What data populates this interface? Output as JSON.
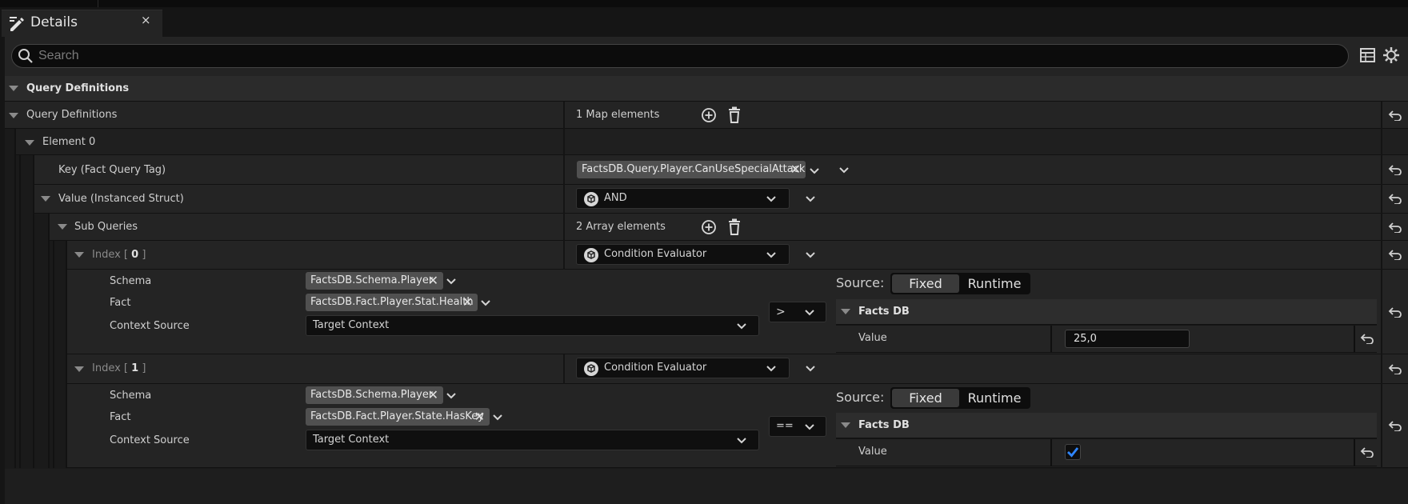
{
  "tab": {
    "title": "Details",
    "close": "×"
  },
  "search": {
    "placeholder": "Search"
  },
  "section": {
    "title": "Query Definitions"
  },
  "map": {
    "label": "Query Definitions",
    "count": "1 Map elements"
  },
  "element": {
    "label": "Element 0"
  },
  "key": {
    "label": "Key (Fact Query Tag)",
    "value": "FactsDB.Query.Player.CanUseSpecialAttack"
  },
  "value_struct": {
    "label": "Value (Instanced Struct)",
    "value": "AND"
  },
  "subqueries": {
    "label": "Sub Queries",
    "count": "2 Array elements"
  },
  "queries": [
    {
      "index_prefix": "Index [",
      "index": "0",
      "index_suffix": "]",
      "type": "Condition Evaluator",
      "schema_label": "Schema",
      "schema": "FactsDB.Schema.Player",
      "fact_label": "Fact",
      "fact": "FactsDB.Fact.Player.Stat.Health",
      "context_label": "Context Source",
      "context": "Target Context",
      "operator": ">",
      "source_label": "Source:",
      "fixed": "Fixed",
      "runtime": "Runtime",
      "facts_db": "Facts DB",
      "value_label": "Value",
      "value": "25,0"
    },
    {
      "index_prefix": "Index [",
      "index": "1",
      "index_suffix": "]",
      "type": "Condition Evaluator",
      "schema_label": "Schema",
      "schema": "FactsDB.Schema.Player",
      "fact_label": "Fact",
      "fact": "FactsDB.Fact.Player.State.HasKey",
      "context_label": "Context Source",
      "context": "Target Context",
      "operator": "==",
      "source_label": "Source:",
      "fixed": "Fixed",
      "runtime": "Runtime",
      "facts_db": "Facts DB",
      "value_label": "Value",
      "value_checked": true
    }
  ],
  "icons": {
    "tab": "pencil-icon",
    "search": "search-icon",
    "table": "table-view-icon",
    "settings": "gear-icon",
    "reset": "reset-arrow-icon",
    "add": "add-circle-icon",
    "delete": "trash-icon",
    "struct": "struct-icon"
  },
  "colors": {
    "accent": "#2f86ff",
    "background": "#1a1a1a",
    "row": "#242424"
  }
}
